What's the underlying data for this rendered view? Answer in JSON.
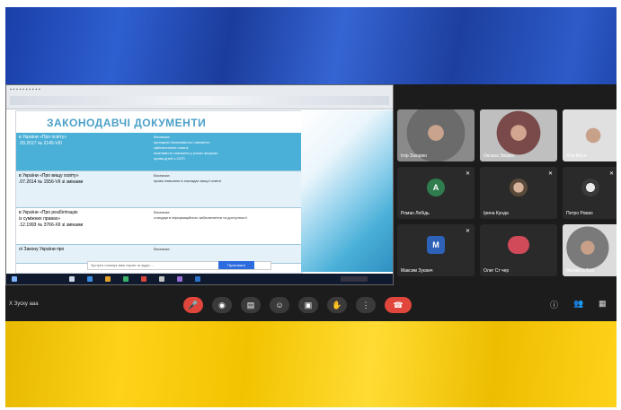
{
  "slide": {
    "title": "ЗАКОНОДАВЧІ ДОКУМЕНТИ",
    "rows": [
      {
        "left": "в України «Про освіту»\n.09.2017 № 2145-VIII",
        "right": "Визначає:\nпринципи інклюзивного навчання;\nзабезпечення освіти;\nможливість навчання у різних формах;\nправа дітей з ООП"
      },
      {
        "left": "в України «Про вищу освіту»\n.07.2014 № 1556-VII зі змінами",
        "right": "Визначає:\nправо навчання в закладах вищої освіти"
      },
      {
        "left": "в України «Про реабілітацію\nіз суміжних правах»\n.12.1993 № 3766-XII зі змінами",
        "right": "Визначає:\nстандарти інформаційного забезпечення та доступності"
      },
      {
        "left": "ої Закону України про",
        "right": "Визначає:"
      }
    ]
  },
  "participants": [
    {
      "name": "Ігор Захарко",
      "initial": "",
      "color": "#5a5a5a",
      "video": true
    },
    {
      "name": "Оксана Зварко",
      "initial": "",
      "color": "#6b5a55",
      "video": true
    },
    {
      "name": "Оля Вася",
      "initial": "",
      "color": "#6b5a55",
      "video": true
    },
    {
      "name": "Роман Лебідь",
      "initial": "A",
      "color": "#2f7d4f",
      "video": false
    },
    {
      "name": "Ірина Кунда",
      "initial": "",
      "color": "#7a6a5a",
      "video": false
    },
    {
      "name": "Петро Рожко",
      "initial": "",
      "color": "#4a4a4a",
      "video": false
    },
    {
      "name": "Максим Зуєвич",
      "initial": "M",
      "color": "#2d62b8",
      "video": false
    },
    {
      "name": "Олег Ст чер",
      "initial": "",
      "color": "#d04a5a",
      "video": false
    },
    {
      "name": "Михайло Бла",
      "initial": "",
      "color": "#444",
      "video": true
    }
  ],
  "meeting": {
    "label": "Х Зуску ааа"
  },
  "controls": [
    "mic-off",
    "video",
    "share",
    "reactions",
    "captions",
    "raise-hand",
    "more",
    "leave"
  ],
  "notif": {
    "text": "Зустрічі показує ваш екран та аудіо ...",
    "button": "Приховати"
  }
}
